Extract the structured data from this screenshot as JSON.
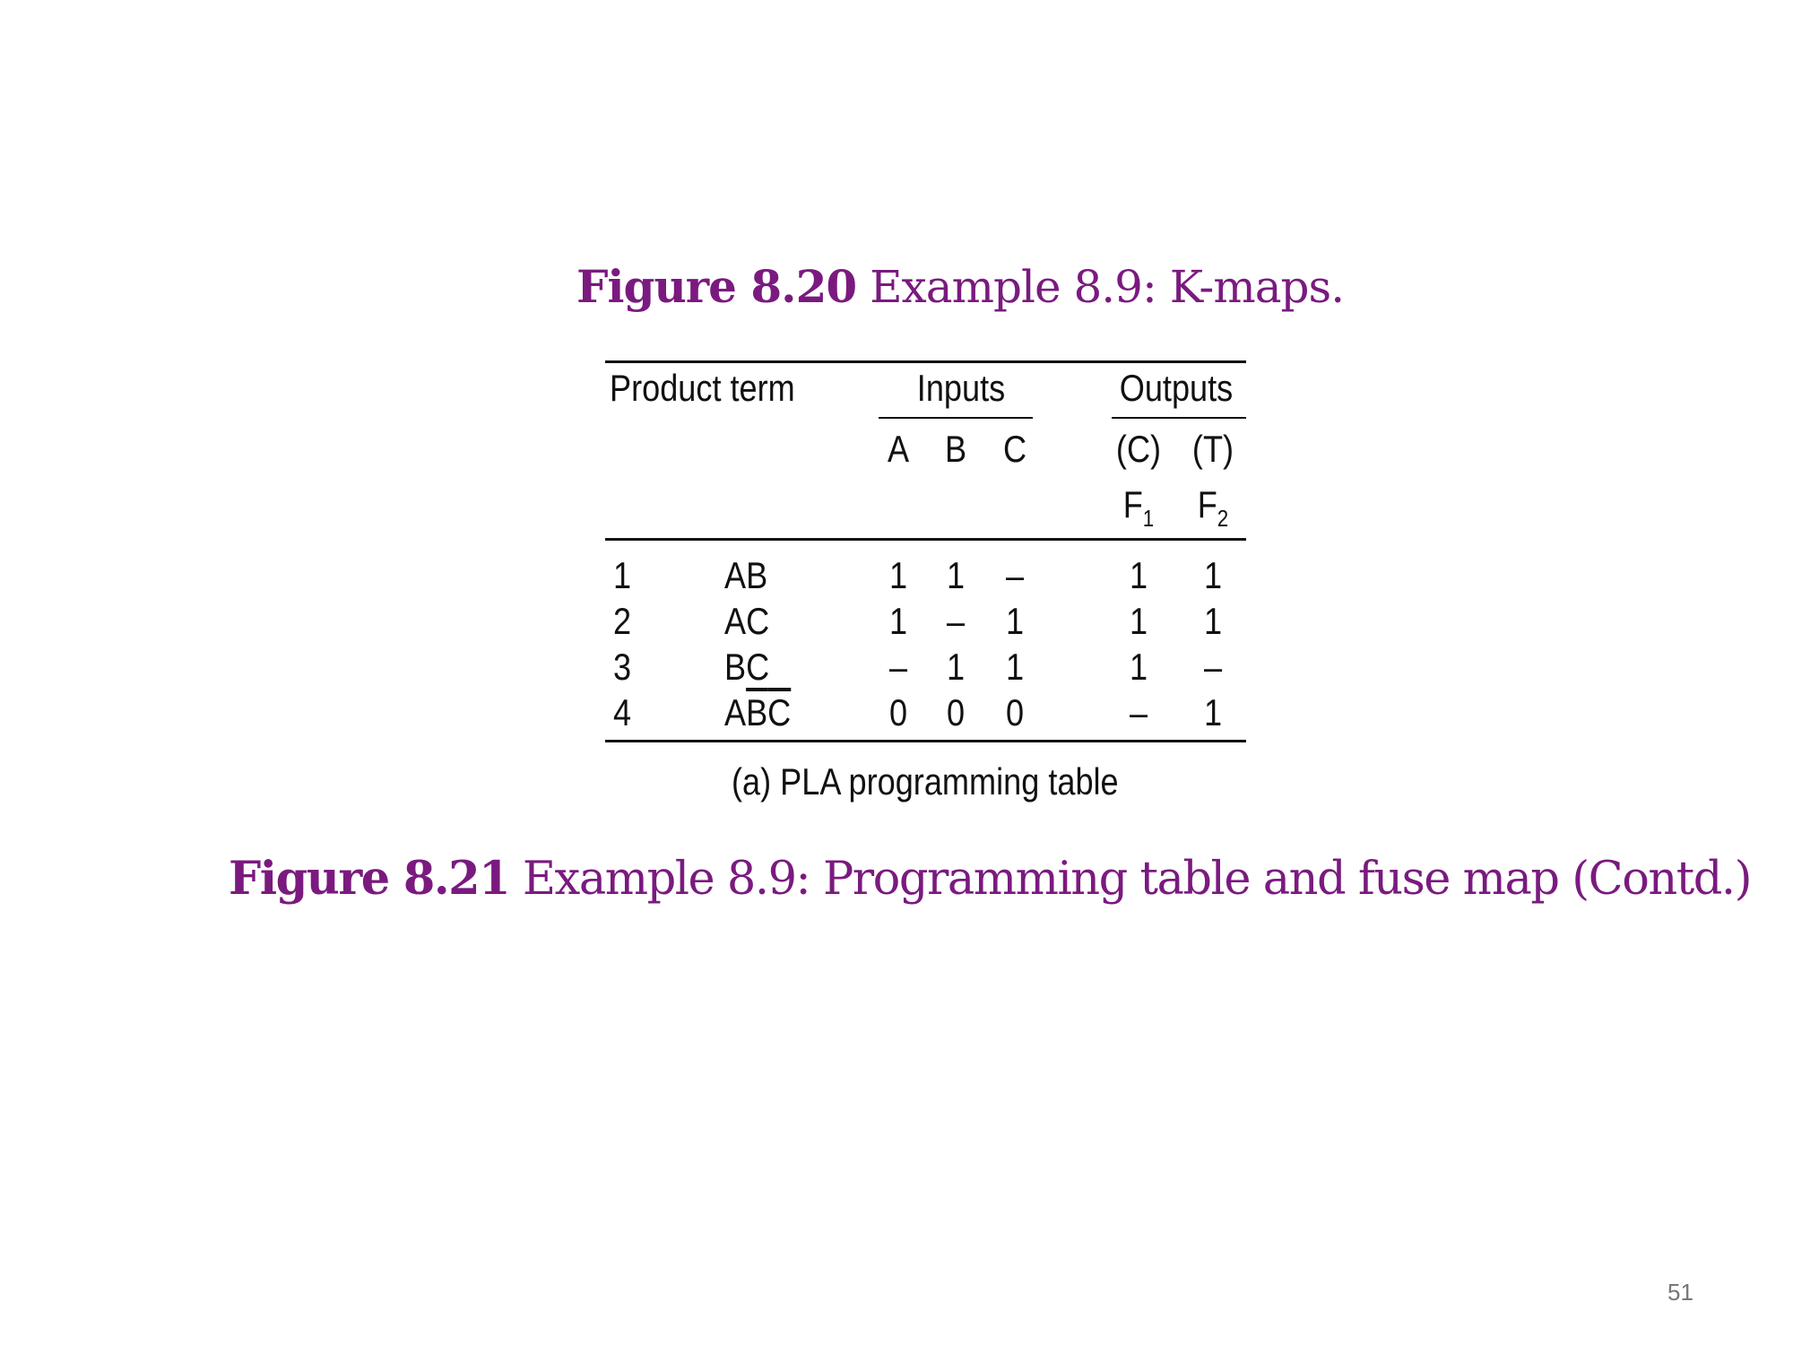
{
  "figure_820": {
    "number": "Figure 8.20",
    "text": "Example 8.9: K-maps."
  },
  "table": {
    "headers": {
      "product_term": "Product term",
      "inputs": "Inputs",
      "outputs": "Outputs",
      "input_cols": [
        "A",
        "B",
        "C"
      ],
      "output_tags": [
        "(C)",
        "(T)"
      ],
      "output_names": [
        {
          "letter": "F",
          "sub": "1"
        },
        {
          "letter": "F",
          "sub": "2"
        }
      ]
    },
    "rows": [
      {
        "num": "1",
        "term": "AB",
        "a": "1",
        "b": "1",
        "c": "–",
        "f1": "1",
        "f2": "1"
      },
      {
        "num": "2",
        "term": "AC",
        "a": "1",
        "b": "–",
        "c": "1",
        "f1": "1",
        "f2": "1"
      },
      {
        "num": "3",
        "term": "BC",
        "a": "–",
        "b": "1",
        "c": "1",
        "f1": "1",
        "f2": "–"
      },
      {
        "num": "4",
        "term_parts": [
          "A",
          "B",
          "C"
        ],
        "term_overline": [
          false,
          true,
          true
        ],
        "a": "0",
        "b": "0",
        "c": "0",
        "f1": "–",
        "f2": "1"
      }
    ],
    "caption": "(a) PLA programming table"
  },
  "figure_821": {
    "number": "Figure 8.21",
    "text": "Example 8.9: Programming table and fuse map (Contd.)"
  },
  "page_number": "51"
}
